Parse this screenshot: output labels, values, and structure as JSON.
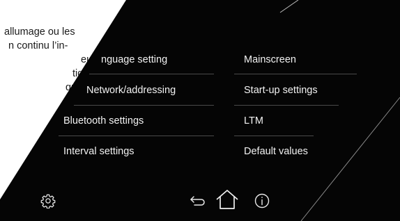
{
  "background_document": {
    "lines": [
      "allumage ou les",
      "n continu l’in-",
      "eur. Ici, vous",
      "tiquement",
      "que écran"
    ]
  },
  "settings_menu": {
    "left_column": [
      {
        "label": "nguage setting"
      },
      {
        "label": "Network/addressing"
      },
      {
        "label": "Bluetooth settings"
      },
      {
        "label": "Interval settings"
      }
    ],
    "right_column": [
      {
        "label": "Mainscreen"
      },
      {
        "label": "Start-up settings"
      },
      {
        "label": "LTM"
      },
      {
        "label": "Default values"
      }
    ]
  },
  "bottom_bar": {
    "icons": [
      "gear-icon",
      "back-arrow-icon",
      "home-icon",
      "info-icon"
    ]
  },
  "colors": {
    "screen_background": "#050505",
    "text": "#f2f2f2",
    "separator": "#4a4a4a"
  }
}
